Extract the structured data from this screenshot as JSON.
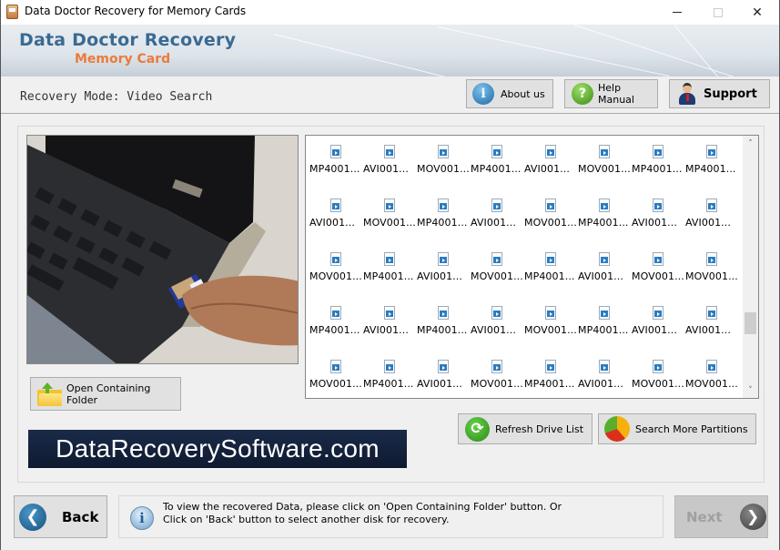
{
  "window": {
    "title": "Data Doctor Recovery for Memory Cards",
    "controls": {
      "minimize": "minimize",
      "maximize": "maximize",
      "close": "✕"
    }
  },
  "header": {
    "brand_main": "Data Doctor Recovery",
    "brand_sub": "Memory Card"
  },
  "recovery_mode": "Recovery Mode: Video Search",
  "toolbar": {
    "about_label": "About us",
    "help_label": "Help Manual",
    "support_label": "Support"
  },
  "icons": {
    "info_glyph": "i",
    "help_glyph": "?",
    "refresh_glyph": "⟳",
    "back_glyph": "❮",
    "next_glyph": "❯",
    "scroll_up": "˄",
    "scroll_down": "˅"
  },
  "files": [
    [
      "MP4001...",
      "AVI001...",
      "MOV001...",
      "MP4001...",
      "AVI001...",
      "MOV001...",
      "MP4001...",
      "MP4001..."
    ],
    [
      "AVI001...",
      "MOV001...",
      "MP4001...",
      "AVI001...",
      "MOV001...",
      "MP4001...",
      "AVI001...",
      "AVI001..."
    ],
    [
      "MOV001...",
      "MP4001...",
      "AVI001...",
      "MOV001...",
      "MP4001...",
      "AVI001...",
      "MOV001...",
      "MOV001..."
    ],
    [
      "MP4001...",
      "AVI001...",
      "MP4001...",
      "AVI001...",
      "MOV001...",
      "MP4001...",
      "AVI001...",
      "AVI001..."
    ],
    [
      "MOV001...",
      "MP4001...",
      "AVI001...",
      "MOV001...",
      "MP4001...",
      "AVI001...",
      "MOV001...",
      "MOV001..."
    ]
  ],
  "actions": {
    "open_folder_label": "Open Containing Folder",
    "refresh_label": "Refresh Drive List",
    "search_partitions_label": "Search More Partitions"
  },
  "banner": "DataRecoverySoftware.com",
  "footer": {
    "back_label": "Back",
    "next_label": "Next",
    "next_enabled": false,
    "info_line1": "To view the recovered Data, please click on 'Open Containing Folder' button. Or",
    "info_line2": "Click on 'Back' button to select another disk for recovery."
  },
  "colors": {
    "brand_blue": "#3a6a92",
    "brand_orange": "#ec7a3c",
    "banner_bg": "#142240"
  }
}
